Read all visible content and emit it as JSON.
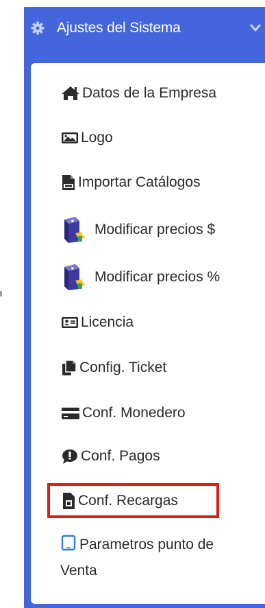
{
  "header": {
    "title": "Ajustes del Sistema",
    "icon": "gear-icon",
    "expand_icon": "chevron-down-icon"
  },
  "menu": {
    "items": [
      {
        "label": "Datos de la Empresa",
        "icon": "home-icon"
      },
      {
        "label": "Logo",
        "icon": "image-icon"
      },
      {
        "label": "Importar Catálogos",
        "icon": "csv-file-icon"
      },
      {
        "label": "Modificar precios $",
        "icon": "price-tag-icon"
      },
      {
        "label": "Modificar precios %",
        "icon": "price-tag-icon"
      },
      {
        "label": "Licencia",
        "icon": "id-card-icon"
      },
      {
        "label": "Config. Ticket",
        "icon": "copy-icon"
      },
      {
        "label": "Conf. Monedero",
        "icon": "credit-card-icon"
      },
      {
        "label": "Conf. Pagos",
        "icon": "comment-icon"
      },
      {
        "label": "Conf. Recargas",
        "icon": "sim-card-icon",
        "highlighted": true
      },
      {
        "label": "Parametros punto de Venta",
        "icon": "tablet-icon"
      }
    ]
  },
  "colors": {
    "header_bg": "#4466dc",
    "card_bg": "#ffffff",
    "text": "#2a2a2a",
    "highlight": "#e21b1b",
    "link_icon": "#2a7fd4"
  }
}
